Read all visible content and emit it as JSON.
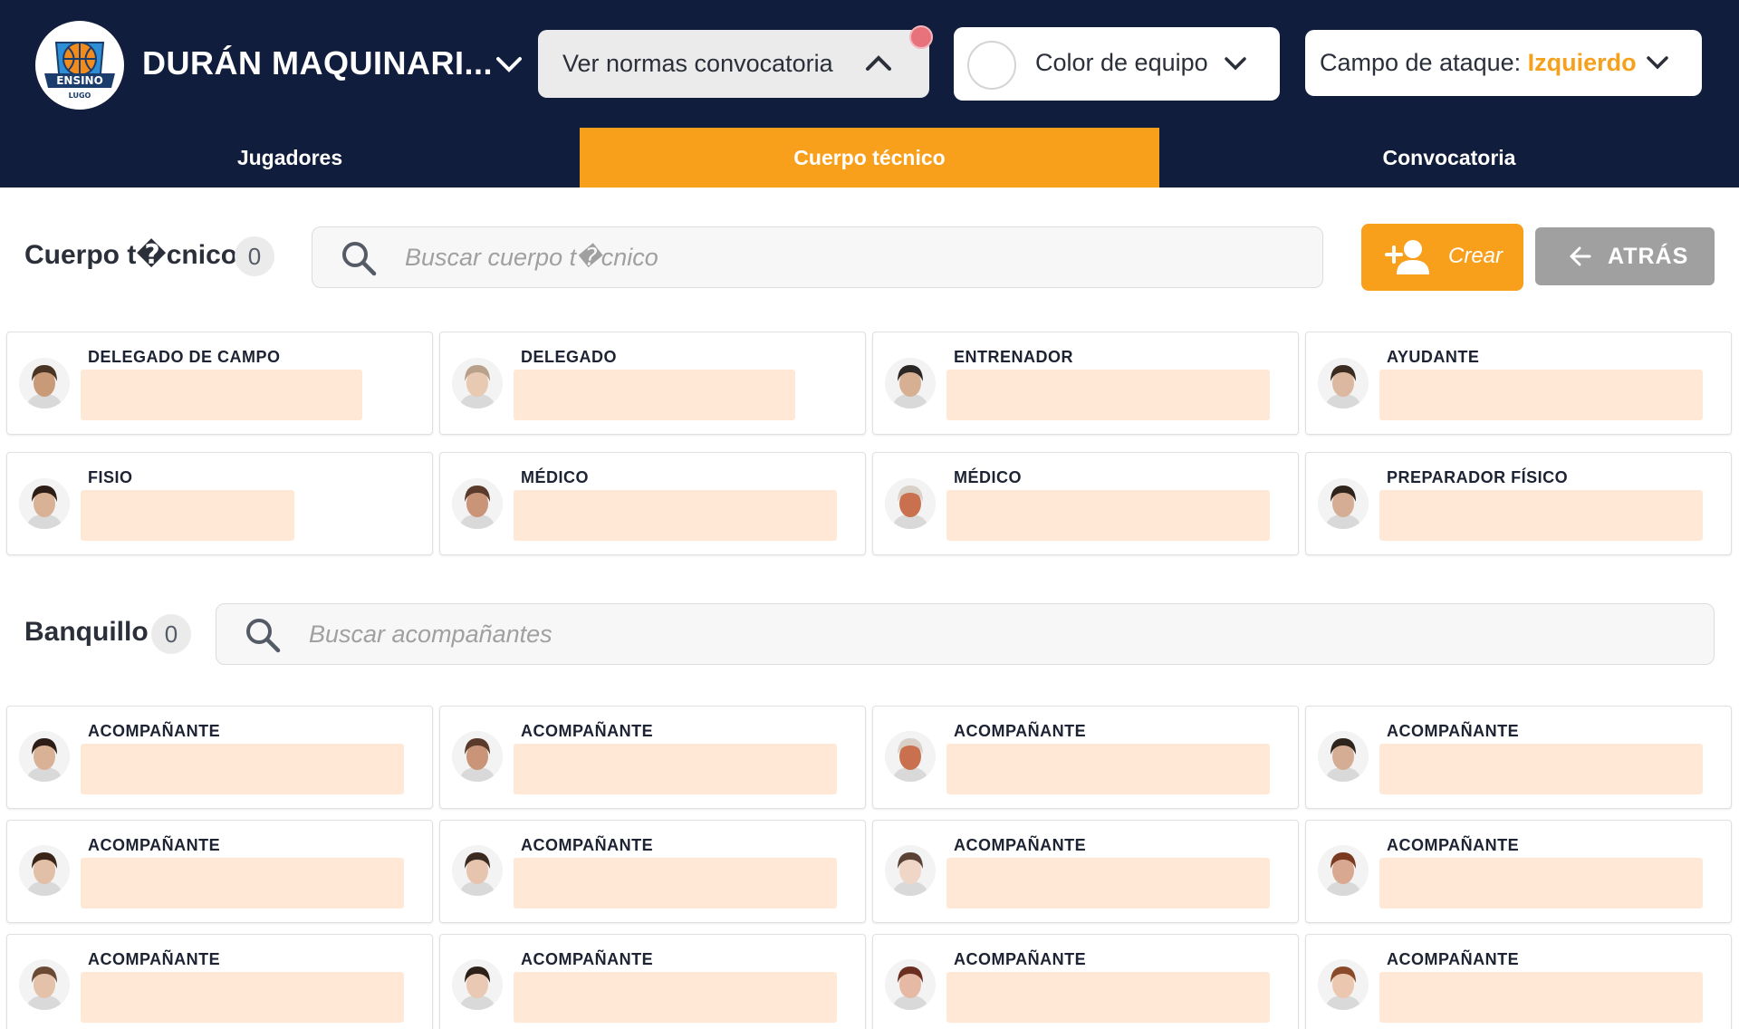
{
  "header": {
    "team_name": "DURÁN MAQUINARI...",
    "logo_text_top": "ENSINO",
    "logo_text_bottom": "LUGO",
    "rules_dropdown": "Ver normas convocatoria",
    "color_dropdown": "Color de equipo",
    "attack_label": "Campo de ataque: ",
    "attack_value": "Izquierdo",
    "accent_color": "#f89f1c",
    "bg_color": "#111d3c"
  },
  "tabs": [
    {
      "label": "Jugadores",
      "active": false
    },
    {
      "label": "Cuerpo técnico",
      "active": true
    },
    {
      "label": "Convocatoria",
      "active": false
    }
  ],
  "staff": {
    "title": "Cuerpo t�cnico",
    "count": "0",
    "search_placeholder": "Buscar cuerpo t�cnico",
    "create_label": "Crear",
    "back_label": "ATRÁS",
    "members": [
      {
        "role": "DELEGADO DE CAMPO"
      },
      {
        "role": "DELEGADO"
      },
      {
        "role": "ENTRENADOR"
      },
      {
        "role": "AYUDANTE"
      },
      {
        "role": "FISIO"
      },
      {
        "role": "MÉDICO"
      },
      {
        "role": "MÉDICO"
      },
      {
        "role": "PREPARADOR FÍSICO"
      }
    ]
  },
  "bench": {
    "title": "Banquillo",
    "count": "0",
    "search_placeholder": "Buscar acompañantes",
    "members": [
      {
        "role": "ACOMPAÑANTE"
      },
      {
        "role": "ACOMPAÑANTE"
      },
      {
        "role": "ACOMPAÑANTE"
      },
      {
        "role": "ACOMPAÑANTE"
      },
      {
        "role": "ACOMPAÑANTE"
      },
      {
        "role": "ACOMPAÑANTE"
      },
      {
        "role": "ACOMPAÑANTE"
      },
      {
        "role": "ACOMPAÑANTE"
      },
      {
        "role": "ACOMPAÑANTE"
      },
      {
        "role": "ACOMPAÑANTE"
      },
      {
        "role": "ACOMPAÑANTE"
      },
      {
        "role": "ACOMPAÑANTE"
      }
    ]
  }
}
